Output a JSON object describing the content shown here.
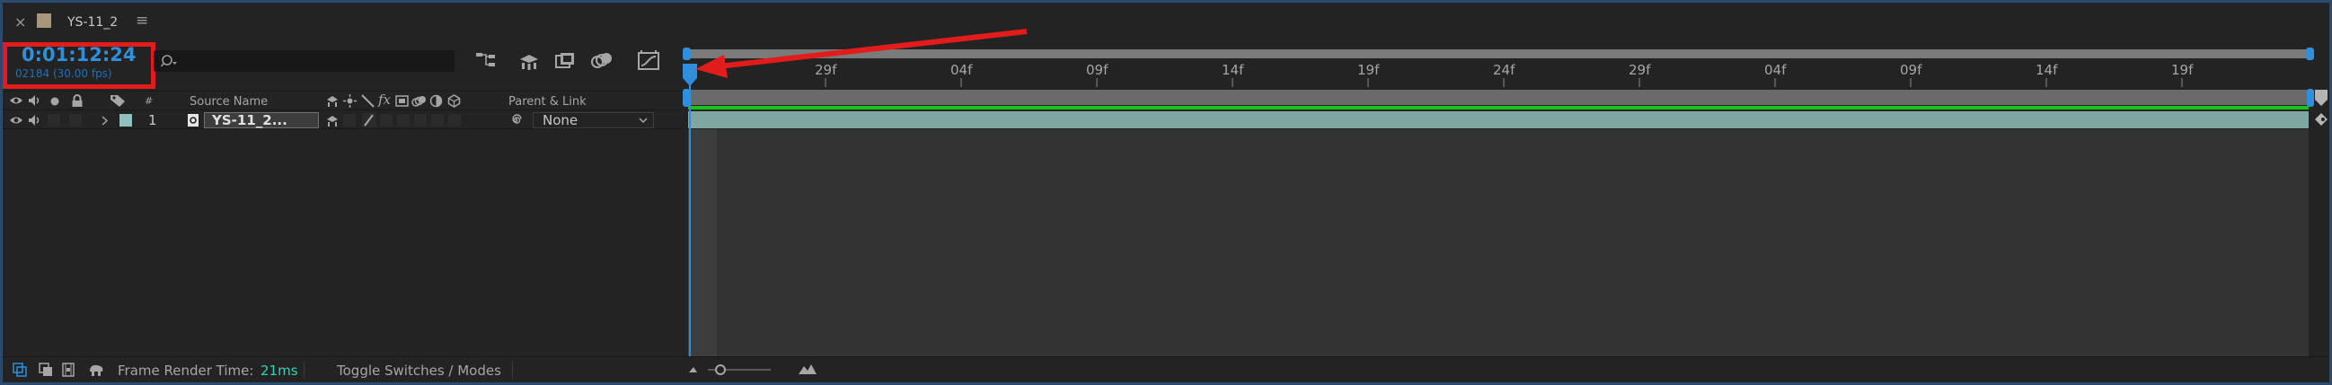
{
  "tab": {
    "close_glyph": "×",
    "title": "YS-11_2",
    "menu_glyph": "≡",
    "swatch_color": "#a8977a"
  },
  "timecode": {
    "value": "0:01:12:24",
    "frames": "02184 (30.00 fps)"
  },
  "search": {
    "placeholder": ""
  },
  "columns": {
    "number": "#",
    "source_name": "Source Name",
    "fx": "fx",
    "parent_link": "Parent & Link"
  },
  "layer": {
    "number": "1",
    "name": "YS-11_2...",
    "parent": "None",
    "label_color": "#8fc2bd",
    "bar_color": "#7fa7a2"
  },
  "ruler": {
    "labels": [
      "29f",
      "04f",
      "09f",
      "14f",
      "19f",
      "24f",
      "29f",
      "04f",
      "09f",
      "14f",
      "19f"
    ]
  },
  "status": {
    "render_label": "Frame Render Time:",
    "render_value": "21ms",
    "toggle_label": "Toggle Switches / Modes"
  },
  "colors": {
    "accent_blue": "#2f8fdc",
    "highlight_red": "#e21b1b",
    "work_area_green": "#19c119",
    "panel_border": "#2c4a6e"
  }
}
